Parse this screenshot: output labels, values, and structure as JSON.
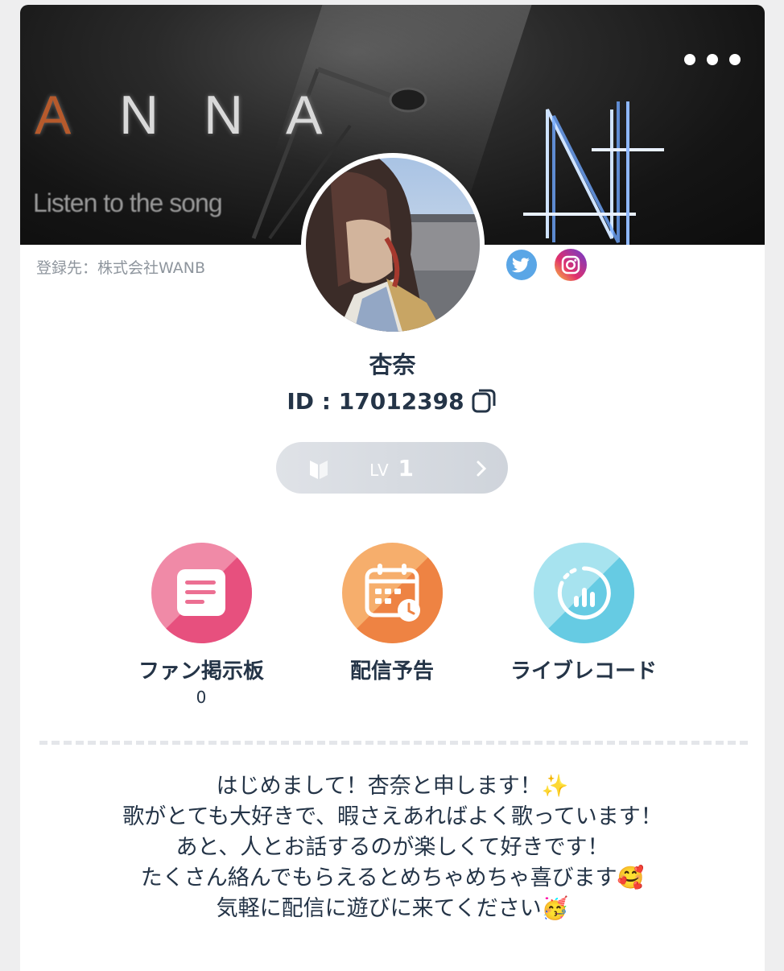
{
  "banner": {
    "letters": [
      "A",
      "N",
      "N",
      "A"
    ],
    "subtitle": "Listen to the song"
  },
  "profile": {
    "registered": "登録先：株式会社WANB",
    "name": "杏奈",
    "id_text": "ID : 17012398"
  },
  "level": {
    "prefix": "LV",
    "value": "1"
  },
  "features": [
    {
      "label": "ファン掲示板",
      "count": "0",
      "icon": "bulletin-board-icon",
      "color": "#ec6f92"
    },
    {
      "label": "配信予告",
      "icon": "calendar-clock-icon",
      "color": "#f29a52"
    },
    {
      "label": "ライブレコード",
      "icon": "live-record-icon",
      "color": "#7fd3e6"
    }
  ],
  "intro": [
    "はじめまして！杏奈と申します！✨",
    "歌がとても大好きで、暇さえあればよく歌っています！",
    "あと、人とお話するのが楽しくて好きです！",
    "たくさん絡んでもらえるとめちゃめちゃ喜びます🥰",
    "気軽に配信に遊びに来てください🥳"
  ],
  "social": [
    {
      "icon": "twitter-icon",
      "color": "#4a9de4"
    },
    {
      "icon": "instagram-icon",
      "color": "#c13584"
    }
  ]
}
